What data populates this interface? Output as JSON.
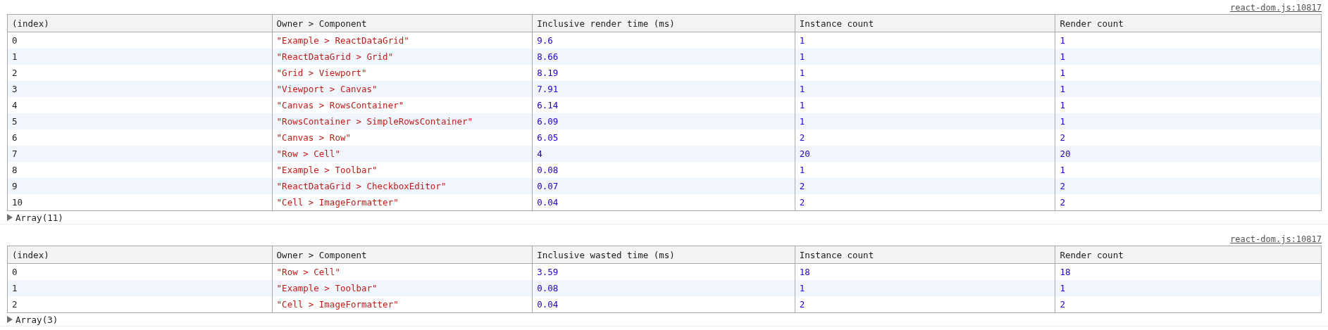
{
  "messages": [
    {
      "source": "react-dom.js:10817",
      "columns": [
        {
          "label": "(index)",
          "kind": "index"
        },
        {
          "label": "Owner > Component",
          "kind": "string"
        },
        {
          "label": "Inclusive render time (ms)",
          "kind": "number"
        },
        {
          "label": "Instance count",
          "kind": "number"
        },
        {
          "label": "Render count",
          "kind": "number"
        }
      ],
      "rows": [
        [
          "0",
          "\"Example > ReactDataGrid\"",
          "9.6",
          "1",
          "1"
        ],
        [
          "1",
          "\"ReactDataGrid > Grid\"",
          "8.66",
          "1",
          "1"
        ],
        [
          "2",
          "\"Grid > Viewport\"",
          "8.19",
          "1",
          "1"
        ],
        [
          "3",
          "\"Viewport > Canvas\"",
          "7.91",
          "1",
          "1"
        ],
        [
          "4",
          "\"Canvas > RowsContainer\"",
          "6.14",
          "1",
          "1"
        ],
        [
          "5",
          "\"RowsContainer > SimpleRowsContainer\"",
          "6.09",
          "1",
          "1"
        ],
        [
          "6",
          "\"Canvas > Row\"",
          "6.05",
          "2",
          "2"
        ],
        [
          "7",
          "\"Row > Cell\"",
          "4",
          "20",
          "20"
        ],
        [
          "8",
          "\"Example > Toolbar\"",
          "0.08",
          "1",
          "1"
        ],
        [
          "9",
          "\"ReactDataGrid > CheckboxEditor\"",
          "0.07",
          "2",
          "2"
        ],
        [
          "10",
          "\"Cell > ImageFormatter\"",
          "0.04",
          "2",
          "2"
        ]
      ],
      "summary": "Array(11)"
    },
    {
      "source": "react-dom.js:10817",
      "columns": [
        {
          "label": "(index)",
          "kind": "index"
        },
        {
          "label": "Owner > Component",
          "kind": "string"
        },
        {
          "label": "Inclusive wasted time (ms)",
          "kind": "number"
        },
        {
          "label": "Instance count",
          "kind": "number"
        },
        {
          "label": "Render count",
          "kind": "number"
        }
      ],
      "rows": [
        [
          "0",
          "\"Row > Cell\"",
          "3.59",
          "18",
          "18"
        ],
        [
          "1",
          "\"Example > Toolbar\"",
          "0.08",
          "1",
          "1"
        ],
        [
          "2",
          "\"Cell > ImageFormatter\"",
          "0.04",
          "2",
          "2"
        ]
      ],
      "summary": "Array(3)"
    }
  ]
}
